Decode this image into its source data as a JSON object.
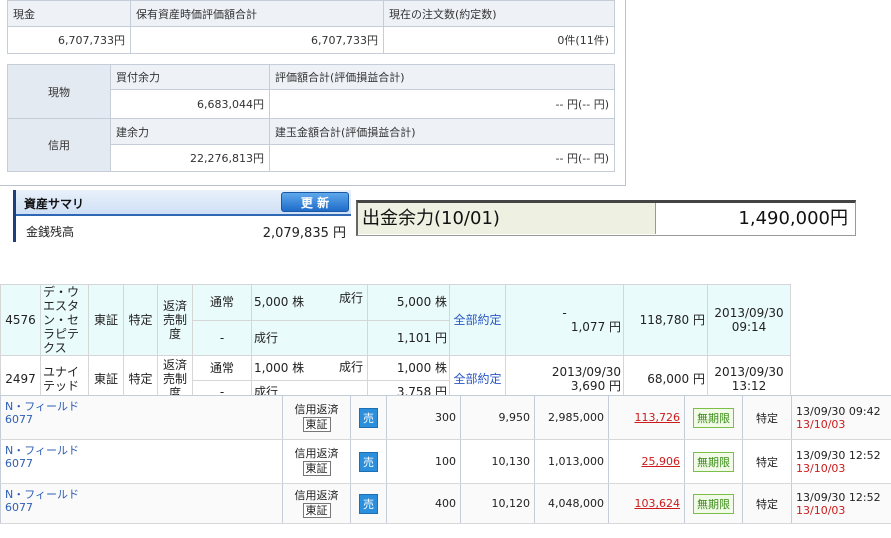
{
  "top_summary": {
    "headers": [
      "現金",
      "保有資産時価評価額合計",
      "現在の注文数(約定数)"
    ],
    "values": [
      "6,707,733円",
      "6,707,733円",
      "0件(11件)"
    ]
  },
  "margin_table": {
    "genbutsu": {
      "row_label": "現物",
      "available_label": "買付余力",
      "available_value": "6,683,044円",
      "eval_label": "評価額合計(評価損益合計)",
      "eval_value": "-- 円(-- 円)"
    },
    "shinyo": {
      "row_label": "信用",
      "available_label": "建余力",
      "available_value": "22,276,813円",
      "eval_label": "建玉金額合計(評価損益合計)",
      "eval_value": "-- 円(-- 円)"
    }
  },
  "asset_summary": {
    "title": "資産サマリ",
    "update_button": "更 新",
    "cash_label": "金銭残高",
    "cash_value": "2,079,835 円"
  },
  "withdrawal": {
    "label": "出金余力(10/01)",
    "value": "1,490,000円"
  },
  "orders": [
    {
      "code": "4576",
      "name": "デ・ウエスタン・セラピテクス",
      "market": "東証",
      "account": "特定",
      "type": "返済売制度",
      "cond1": "通常",
      "qty1": "5,000 株",
      "exec1": "成行",
      "qty_total": "5,000 株",
      "cond2": "-",
      "exec2": "成行",
      "price": "1,101 円",
      "status": "全部約定",
      "exec_date": "-",
      "exec_price": "1,077 円",
      "amount": "118,780 円",
      "order_date": "2013/09/30",
      "order_time": "09:14"
    },
    {
      "code": "2497",
      "name": "ユナイテッド",
      "market": "東証",
      "account": "特定",
      "type": "返済売制度",
      "cond1": "通常",
      "qty1": "1,000 株",
      "exec1": "成行",
      "qty_total": "1,000 株",
      "cond2": "-",
      "exec2": "成行",
      "price": "3,758 円",
      "status": "全部約定",
      "exec_date": "2013/09/30",
      "exec_price": "3,690 円",
      "amount": "68,000 円",
      "order_date": "2013/09/30",
      "order_time": "13:12"
    }
  ],
  "positions": [
    {
      "name": "N・フィールド",
      "code": "6077",
      "kind": "信用返済",
      "market": "東証",
      "side": "売",
      "qty": "300",
      "price": "9,950",
      "amount": "2,985,000",
      "pl": "113,726",
      "term": "無期限",
      "account": "特定",
      "date1": "13/09/30 09:42",
      "date2": "13/10/03"
    },
    {
      "name": "N・フィールド",
      "code": "6077",
      "kind": "信用返済",
      "market": "東証",
      "side": "売",
      "qty": "100",
      "price": "10,130",
      "amount": "1,013,000",
      "pl": "25,906",
      "term": "無期限",
      "account": "特定",
      "date1": "13/09/30 12:52",
      "date2": "13/10/03"
    },
    {
      "name": "N・フィールド",
      "code": "6077",
      "kind": "信用返済",
      "market": "東証",
      "side": "売",
      "qty": "400",
      "price": "10,120",
      "amount": "4,048,000",
      "pl": "103,624",
      "term": "無期限",
      "account": "特定",
      "date1": "13/09/30 12:52",
      "date2": "13/10/03"
    }
  ],
  "colors": {
    "accent_blue": "#2b8fdc",
    "header_bg": "#eef2f7",
    "profit_red": "#cc1b1b",
    "order_row_bg": "#eafbfb"
  }
}
